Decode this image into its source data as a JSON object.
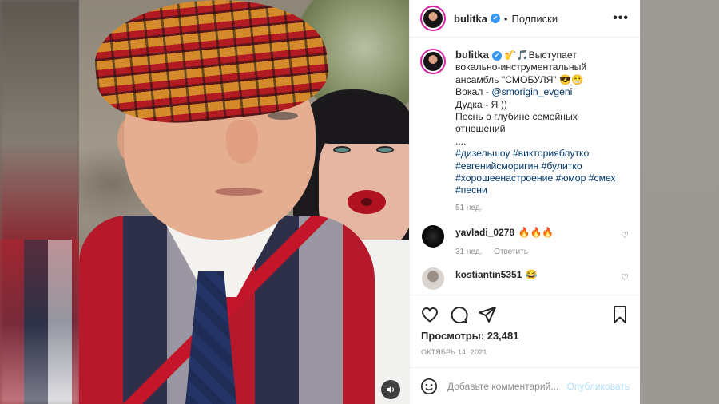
{
  "post": {
    "author": "bulitka",
    "follow_label": "Подписки",
    "more_label": "•••",
    "sound_icon": "speaker-icon"
  },
  "caption": {
    "username": "bulitka",
    "line_intro": "🎷🎵Выступает вокально-инструментальный ансамбль \"СМОБУЛЯ\" 😎😁",
    "vocal_prefix": "Вокал - ",
    "vocal_mention": "@smorigin_evgeni",
    "line_duduk": "Дудка - Я ))",
    "line_song": "Песнь о глубине семейных отношений",
    "ellipsis": "....",
    "hashtags": "#дизельшоу #викторияблутко #евгенийсморигин #булитко #хорошеенастроение #юмор #смех #песни",
    "age": "51 нед."
  },
  "comments": [
    {
      "username": "yavladi_0278",
      "text": "🔥🔥🔥",
      "age": "31 нед.",
      "reply_label": "Ответить"
    },
    {
      "username": "kostiantin5351",
      "text": "😂"
    }
  ],
  "stats": {
    "views_label": "Просмотры: 23,481",
    "date": "ОКТЯБРЬ 14, 2021"
  },
  "composer": {
    "placeholder": "Добавьте комментарий...",
    "publish_label": "Опубликовать"
  },
  "colors": {
    "link": "#00376b",
    "verified": "#3897f0",
    "publish_disabled": "#b2dffc"
  }
}
